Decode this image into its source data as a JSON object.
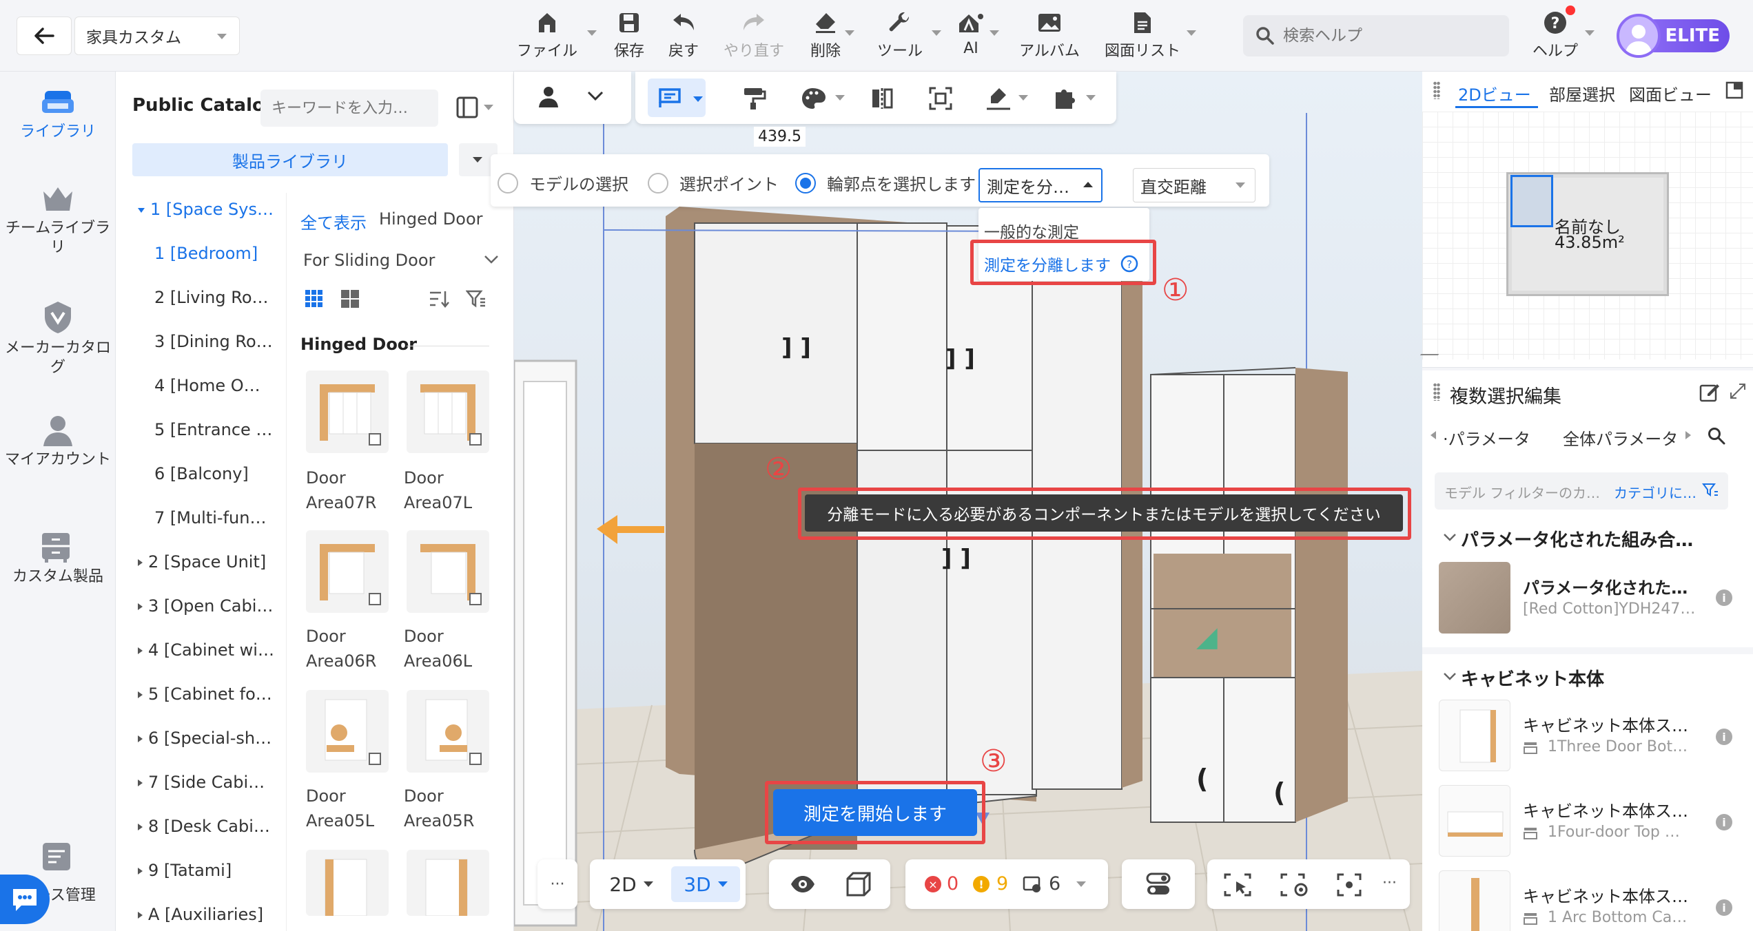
{
  "header": {
    "back_label": "",
    "project_name": "家具カスタム",
    "toolbar": {
      "file": "ファイル",
      "save": "保存",
      "undo": "戻す",
      "redo": "やり直す",
      "delete": "削除",
      "tools": "ツール",
      "ai": "AI",
      "album": "アルバム",
      "drawing_list": "図面リスト"
    },
    "search_placeholder": "検索ヘルプ",
    "help": "ヘルプ",
    "badge": "ELITE"
  },
  "left_nav": {
    "items": [
      {
        "label": "ライブラリ"
      },
      {
        "label": "チームライブラリ"
      },
      {
        "label": "メーカーカタログ"
      },
      {
        "label": "マイアカウント"
      },
      {
        "label": "カスタム製品"
      },
      {
        "label": "ース管理"
      }
    ]
  },
  "catalog": {
    "title": "Public Catalog",
    "search_placeholder": "キーワードを入力…",
    "library_tab": "製品ライブラリ",
    "tree": [
      "1 [Space Sys…",
      "1 [Bedroom]",
      "2 [Living Ro…",
      "3 [Dining Ro…",
      "4 [Home O…",
      "5 [Entrance …",
      "6 [Balcony]",
      "7 [Multi-fun…",
      "2 [Space Unit]",
      "3 [Open Cabi…",
      "4 [Cabinet wi…",
      "5 [Cabinet fo…",
      "6 [Special-sh…",
      "7 [Side Cabi…",
      "8 [Desk Cabi…",
      "9 [Tatami]",
      "A [Auxiliaries]"
    ],
    "show_all": "全て表示",
    "filter_hinged": "Hinged Door",
    "filter_sliding": "For Sliding Door",
    "section_title": "Hinged Door",
    "products": [
      {
        "name": "Door Area07R"
      },
      {
        "name": "Door Area07L"
      },
      {
        "name": "Door Area06R"
      },
      {
        "name": "Door Area06L"
      },
      {
        "name": "Door Area05L"
      },
      {
        "name": "Door Area05R"
      }
    ]
  },
  "viewport": {
    "dimension_label": "439.5",
    "measure_bar": {
      "model_select": "モデルの選択",
      "point_select": "選択ポイント",
      "contour_select": "輪郭点を選択します",
      "mode_dropdown": "測定を分…",
      "distance_dropdown": "直交距離"
    },
    "dropdown_options": {
      "general": "一般的な測定",
      "separate": "測定を分離します"
    },
    "tooltip": "分離モードに入る必要があるコンポーネントまたはモデルを選択してください",
    "start_button": "測定を開始します",
    "markers": {
      "one": "①",
      "two": "②",
      "three": "③"
    },
    "bottom_bar": {
      "more": "···",
      "mode_2d": "2D",
      "mode_3d": "3D",
      "errors": "0",
      "warnings": "9",
      "notices": "6"
    }
  },
  "right_panel": {
    "tabs": [
      "2Dビュー",
      "部屋選択",
      "図面ビュー"
    ],
    "room_name": "名前なし",
    "room_area": "43.85m²",
    "multi_edit_title": "複数選択編集",
    "param_tab": "·パラメータ",
    "all_param_tab": "全体パラメータ",
    "filter_placeholder": "モデル フィルターのカ…",
    "filter_category": "カテゴリに…",
    "group1_title": "パラメータ化された組み合…",
    "group1_items": [
      {
        "title": "パラメータ化された…",
        "sub": "[Red Cotton]YDH247…"
      }
    ],
    "group2_title": "キャビネット本体",
    "group2_items": [
      {
        "title": "キャビネット本体ス…",
        "sub": "1Three Door Bot…"
      },
      {
        "title": "キャビネット本体ス…",
        "sub": "1Four-door Top …"
      },
      {
        "title": "キャビネット本体ス…",
        "sub": "1 Arc Bottom Ca…"
      }
    ]
  },
  "colors": {
    "accent": "#1a73e8",
    "highlight_red": "#e84545",
    "elite_purple": "#7b5cf0"
  }
}
